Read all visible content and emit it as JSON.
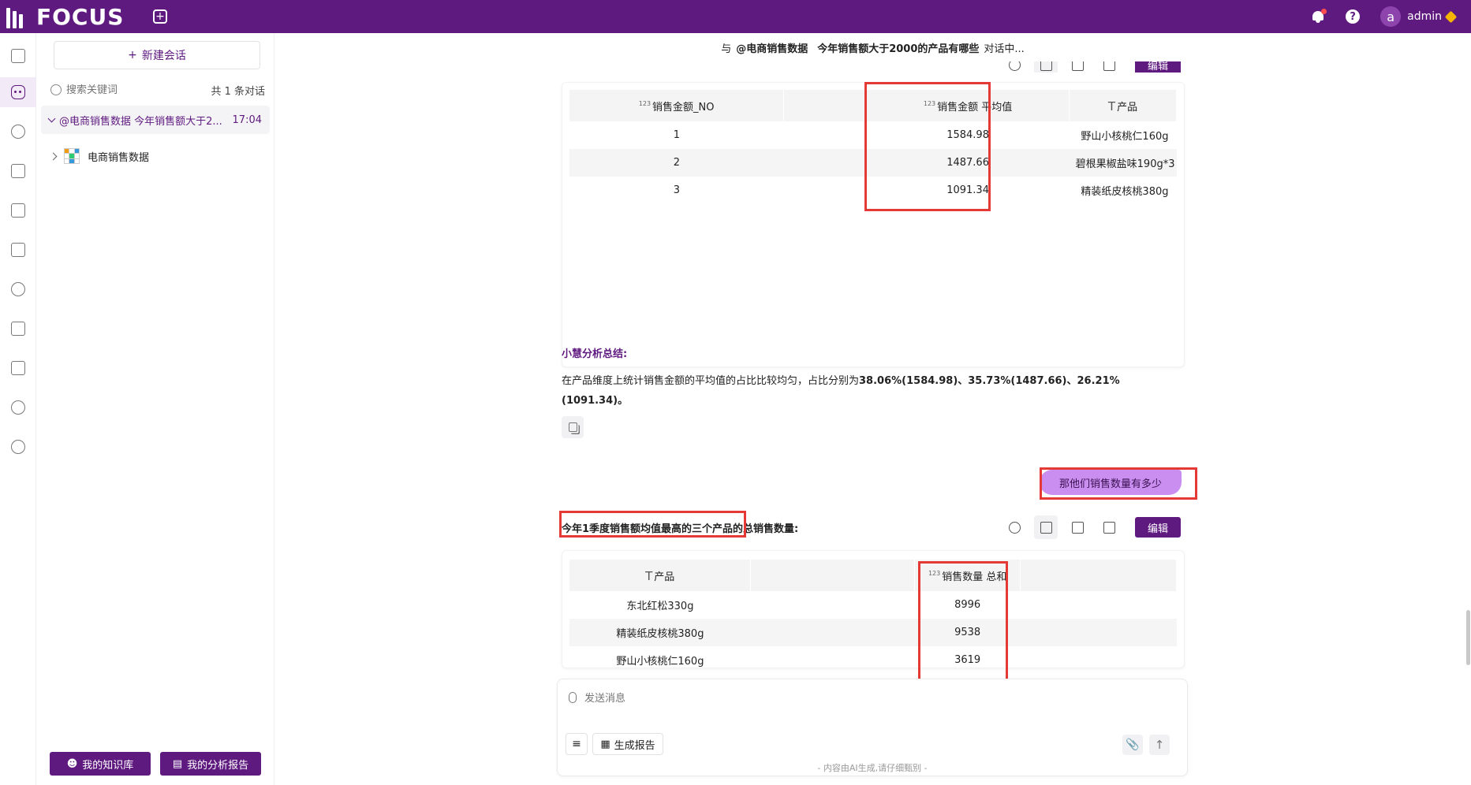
{
  "app": {
    "logo_text": "FOCUS"
  },
  "topbar": {
    "username": "admin",
    "avatar_letter": "a",
    "help_label": "?"
  },
  "sidebar": {
    "new_chat_label": "新建会话",
    "search_placeholder": "搜索关键词",
    "count_label": "共 1 条对话",
    "conversation": {
      "title": "@电商销售数据 今年销售额大于2...",
      "time": "17:04"
    },
    "dataset_name": "电商销售数据",
    "knowledge_btn": "我的知识库",
    "report_btn": "我的分析报告"
  },
  "chat": {
    "header": {
      "prefix": "与",
      "dataset": "@电商销售数据",
      "question": "今年销售额大于2000的产品有哪些",
      "suffix": "对话中..."
    },
    "table1": {
      "headers": [
        "销售金额_NO",
        "",
        "销售金额 平均值",
        "产品"
      ],
      "header_types": [
        "123",
        "",
        "123",
        "T"
      ],
      "rows": [
        [
          "1",
          "",
          "1584.98",
          "野山小核桃仁160g"
        ],
        [
          "2",
          "",
          "1487.66",
          "碧根果椒盐味190g*3"
        ],
        [
          "3",
          "",
          "1091.34",
          "精装纸皮核桃380g"
        ]
      ]
    },
    "summary": {
      "title": "小慧分析总结:",
      "text_prefix": "在产品维度上统计销售金额的平均值的占比比较均匀，占比分别为",
      "text_bold": "38.06%(1584.98)、35.73%(1487.66)、26.21%(1091.34)。"
    },
    "user_message": "那他们销售数量有多少",
    "answer_title": "今年1季度销售额均值最高的三个产品的总销售数量:",
    "edit_label": "编辑",
    "table2": {
      "headers": [
        "产品",
        "",
        "销售数量 总和",
        ""
      ],
      "header_types": [
        "T",
        "",
        "123",
        ""
      ],
      "rows": [
        [
          "东北红松330g",
          "",
          "8996",
          ""
        ],
        [
          "精装纸皮核桃380g",
          "",
          "9538",
          ""
        ],
        [
          "野山小核桃仁160g",
          "",
          "3619",
          ""
        ]
      ]
    }
  },
  "input": {
    "placeholder": "发送消息",
    "report_label": "生成报告",
    "send_symbol": "↑",
    "disclaimer": "- 内容由AI生成,请仔细甄别 -"
  },
  "colors": {
    "brand": "#5f1a80",
    "highlight": "#e53935",
    "bubble": "#c98ef0"
  }
}
